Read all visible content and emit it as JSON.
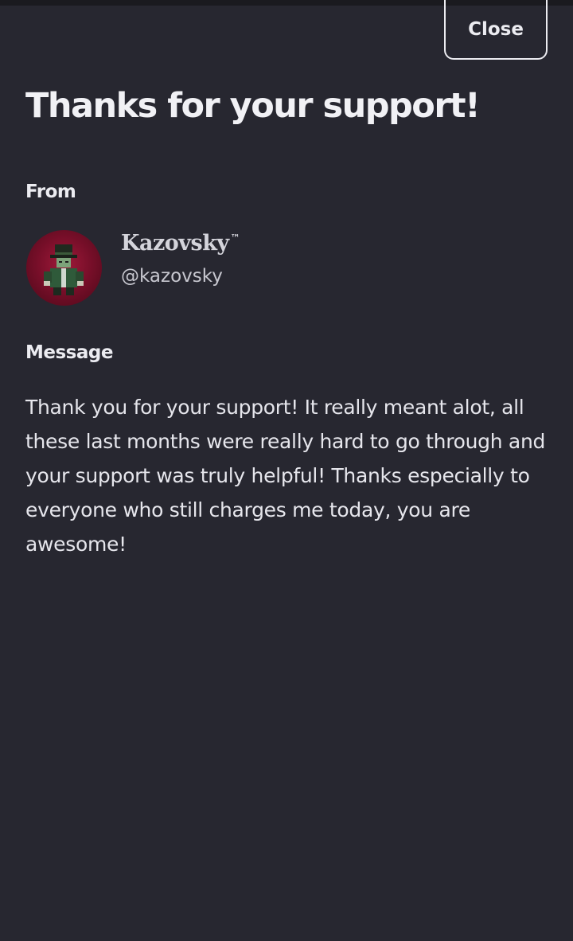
{
  "modal": {
    "close_label": "Close",
    "title": "Thanks for your support!"
  },
  "from": {
    "label": "From",
    "display_name": "Kazovsky",
    "trademark": "™",
    "handle": "@kazovsky"
  },
  "message": {
    "label": "Message",
    "body": "Thank you for your support! It really meant alot, all these last months were really hard to go through and your support was truly helpful! Thanks especially to everyone who still charges me today, you are awesome!"
  },
  "colors": {
    "background": "#272730",
    "text": "#ececf1",
    "avatar_accent": "#a01a3a"
  }
}
